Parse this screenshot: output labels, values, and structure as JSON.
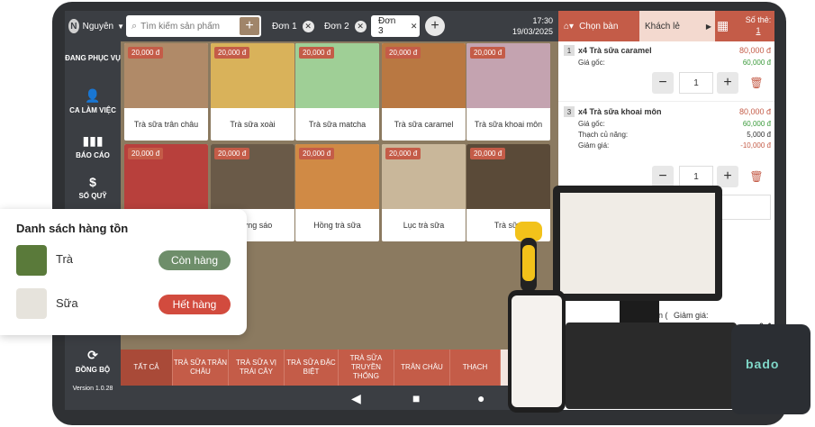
{
  "topbar": {
    "user_initial": "N",
    "user_name": "Nguyên",
    "search_placeholder": "Tìm kiếm sản phẩm",
    "tabs": [
      {
        "label": "Đơn 1"
      },
      {
        "label": "Đơn 2"
      },
      {
        "label": "Đơn 3"
      }
    ],
    "time": "17:30",
    "date": "19/03/2025"
  },
  "order_header": {
    "table_label": "Chọn bàn",
    "customer_label": "Khách lẻ",
    "seat_label": "Số thẻ:",
    "seat_value": "1"
  },
  "sidebar": {
    "items": [
      {
        "label": "ĐANG PHỤC VỤ"
      },
      {
        "label": "CA LÀM VIỆC"
      },
      {
        "label": "BÁO CÁO"
      },
      {
        "label": "SỔ QUỸ"
      },
      {
        "label": "ĐỒNG BỘ"
      }
    ],
    "version": "Version 1.0.28"
  },
  "products": [
    {
      "name": "Trà sữa trân châu",
      "price": "20,000 đ",
      "color": "#b08a68"
    },
    {
      "name": "Trà sữa xoài",
      "price": "20,000 đ",
      "color": "#d9b25a"
    },
    {
      "name": "Trà sữa matcha",
      "price": "20,000 đ",
      "color": "#9fcf96"
    },
    {
      "name": "Trà sữa caramel",
      "price": "20,000 đ",
      "color": "#b97842"
    },
    {
      "name": "Trà sữa khoai môn",
      "price": "20,000 đ",
      "color": "#c4a3b0"
    },
    {
      "name": "",
      "price": "20,000 đ",
      "color": "#b8403c"
    },
    {
      "name": "sương sáo",
      "price": "20,000 đ",
      "color": "#6a5a48"
    },
    {
      "name": "Hồng trà sữa",
      "price": "20,000 đ",
      "color": "#d08a45"
    },
    {
      "name": "Lục trà sữa",
      "price": "20,000 đ",
      "color": "#c9b79a"
    },
    {
      "name": "Trà sữa",
      "price": "20,000 đ",
      "color": "#5a4a38"
    }
  ],
  "categories": [
    {
      "label": "TẤT CẢ"
    },
    {
      "label": "TRÀ SỮA TRÂN CHÂU"
    },
    {
      "label": "TRÀ SỮA VỊ TRÁI CÂY"
    },
    {
      "label": "TRÀ SỮA ĐẶC BIỆT"
    },
    {
      "label": "TRÀ SỮA TRUYỀN THỐNG"
    },
    {
      "label": "TRÂN CHÂU"
    },
    {
      "label": "THẠCH"
    }
  ],
  "order_lines": [
    {
      "index": "1",
      "title": "x4 Trà sữa caramel",
      "total": "80,000 đ",
      "base_label": "Giá gốc:",
      "base_value": "60,000 đ",
      "qty": "1"
    },
    {
      "index": "3",
      "title": "x4 Trà sữa khoai môn",
      "total": "80,000 đ",
      "base_label": "Giá gốc:",
      "base_value": "60,000 đ",
      "topping_label": "Thạch củ năng:",
      "topping_value": "5,000 đ",
      "discount_label": "Giảm giá:",
      "discount_value": "-10,000 đ",
      "qty": "1"
    }
  ],
  "order_footer": {
    "total_label": "ổng tiền (",
    "discount_label": "Giảm giá:",
    "discount_value": "0 đ"
  },
  "inventory": {
    "title": "Danh sách hàng tồn",
    "items": [
      {
        "name": "Trà",
        "status": "Còn hàng",
        "status_color": "#6e8e6a"
      },
      {
        "name": "Sữa",
        "status": "Hết hàng",
        "status_color": "#d24b3e"
      }
    ]
  },
  "printer_brand": "bado",
  "colors": {
    "accent": "#c45c48",
    "dark": "#3b3e43",
    "background": "#8b7a60"
  }
}
